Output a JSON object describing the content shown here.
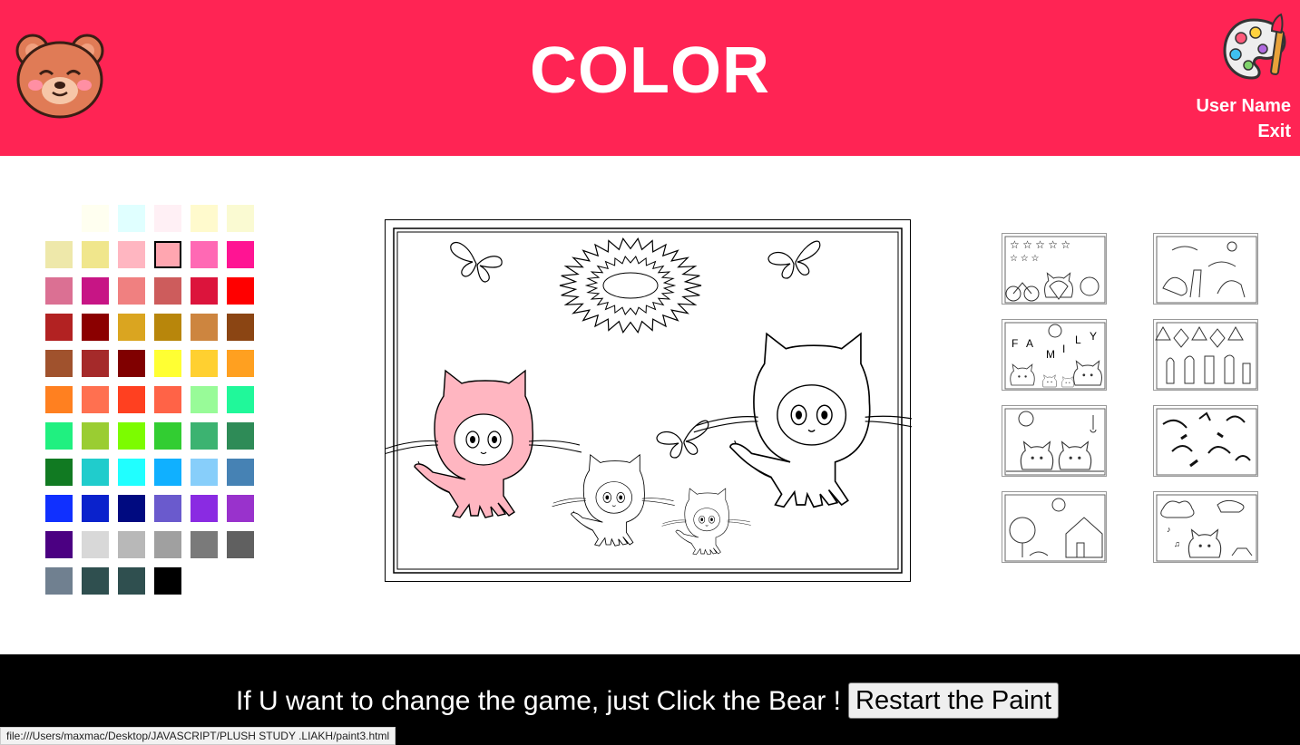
{
  "header": {
    "title": "COLOR",
    "user_name": "User Name",
    "exit_label": "Exit",
    "background": "#ff2454",
    "bear_icon": "bear-face-icon",
    "palette_icon": "paint-palette-icon"
  },
  "palette": {
    "selected_index": 9,
    "colors": [
      "#ffffff",
      "#fffff0",
      "#e0ffff",
      "#fff0f5",
      "#fffacd",
      "#fafad2",
      "#eee8aa",
      "#f0e68c",
      "#ffb6c1",
      "#ffa6b0",
      "#ff69b4",
      "#ff1493",
      "#db7093",
      "#c71585",
      "#f08080",
      "#cd5c5c",
      "#dc143c",
      "#ff0000",
      "#b22222",
      "#8b0000",
      "#daa520",
      "#b8860b",
      "#cd853f",
      "#8b4513",
      "#a0522d",
      "#a52a2a",
      "#800000",
      "#ffff33",
      "#ffd030",
      "#ffa020",
      "#ff8020",
      "#ff7050",
      "#ff4020",
      "#ff6347",
      "#98fb98",
      "#20f89a",
      "#20f080",
      "#9acd32",
      "#7cfc00",
      "#32cd32",
      "#3cb371",
      "#2e8b57",
      "#117a22",
      "#20cccc",
      "#20ffff",
      "#10b0ff",
      "#87cefa",
      "#4682b4",
      "#1030ff",
      "#0a22cc",
      "#000a80",
      "#6a5acd",
      "#8a2be2",
      "#9932cc",
      "#4b0082",
      "#d8d8d8",
      "#b8b8b8",
      "#a0a0a0",
      "#7a7a7a",
      "#606060",
      "#708090",
      "#2f4f4f",
      "#2f4f4f",
      "#000000"
    ]
  },
  "canvas": {
    "fill_colors": {
      "left_cat": "#ffb6c1"
    }
  },
  "thumbnails": [
    {
      "name": "thumb-bicycle-family"
    },
    {
      "name": "thumb-animals"
    },
    {
      "name": "thumb-family",
      "letters": [
        "F",
        "A",
        "M",
        "I",
        "L",
        "Y"
      ]
    },
    {
      "name": "thumb-chess"
    },
    {
      "name": "thumb-bears-summer"
    },
    {
      "name": "thumb-birds"
    },
    {
      "name": "thumb-house-tree"
    },
    {
      "name": "thumb-rainy-bear"
    }
  ],
  "footer": {
    "message": "If U want to change the game, just Click the Bear !",
    "restart_label": "Restart the Paint"
  },
  "status_bar": {
    "url": "file:///Users/maxmac/Desktop/JAVASCRIPT/PLUSH STUDY .LIAKH/paint3.html"
  }
}
